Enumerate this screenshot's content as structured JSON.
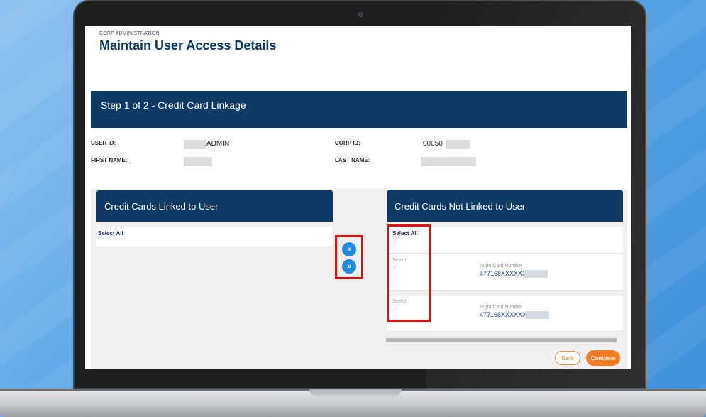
{
  "header": {
    "breadcrumb": "CORP ADMINISTRATION",
    "title": "Maintain User Access Details"
  },
  "step": {
    "title": "Step 1 of 2 - Credit Card Linkage"
  },
  "user_info": {
    "user_id_label": "USER ID:",
    "user_id_value": "ADMIN",
    "corp_id_label": "CORP ID:",
    "corp_id_value": "00050",
    "first_name_label": "FIRST NAME:",
    "last_name_label": "LAST NAME:"
  },
  "linked_panel": {
    "title": "Credit Cards Linked to User",
    "select_all": "Select All"
  },
  "not_linked_panel": {
    "title": "Credit Cards Not Linked to User",
    "select_all": "Select All",
    "cards": [
      {
        "select_label": "Select",
        "card_label": "Right Card Number",
        "card_number": "477168XXXXXX"
      },
      {
        "select_label": "Select",
        "card_label": "Right Card Number",
        "card_number": "477168XXXXXX"
      }
    ]
  },
  "transfer": {
    "move_left_glyph": "«",
    "move_right_glyph": "»"
  },
  "actions": {
    "back": "Back",
    "continue": "Continue"
  },
  "colors": {
    "navy": "#0e3a66",
    "accent_blue": "#1d8ae0",
    "orange": "#f37b21",
    "highlight_red": "#e01010"
  },
  "icons": {
    "checkmark": "check-icon",
    "move_left": "double-chevron-left-icon",
    "move_right": "double-chevron-right-icon"
  }
}
